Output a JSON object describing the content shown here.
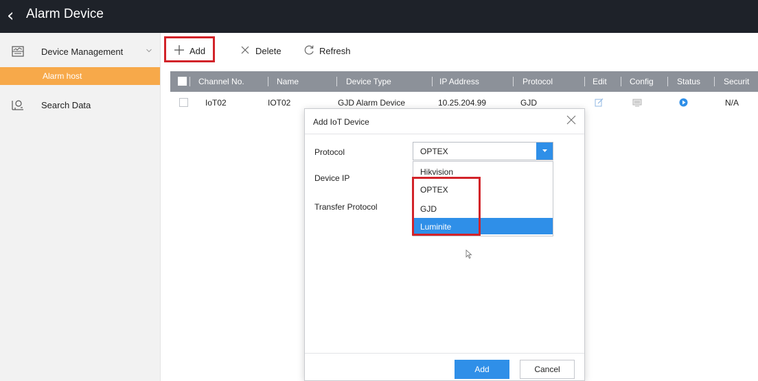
{
  "header": {
    "title": "Alarm Device"
  },
  "sidebar": {
    "items": [
      {
        "label": "Device Management",
        "icon": "device-management-icon"
      },
      {
        "label": "Alarm host"
      },
      {
        "label": "Search Data",
        "icon": "search-data-icon"
      }
    ]
  },
  "toolbar": {
    "add_label": "Add",
    "delete_label": "Delete",
    "refresh_label": "Refresh"
  },
  "table": {
    "columns": [
      "Channel No.",
      "Name",
      "Device Type",
      "IP Address",
      "Protocol",
      "Edit",
      "Config",
      "Status",
      "Securit"
    ],
    "rows": [
      {
        "channel_no": "IoT02",
        "name": "IOT02",
        "device_type": "GJD Alarm Device",
        "ip_address": "10.25.204.99",
        "protocol": "GJD",
        "security": "N/A"
      }
    ]
  },
  "dialog": {
    "title": "Add IoT Device",
    "protocol_label": "Protocol",
    "protocol_value": "OPTEX",
    "device_ip_label": "Device IP",
    "transfer_protocol_label": "Transfer Protocol",
    "protocol_options": [
      "Hikvision",
      "OPTEX",
      "GJD",
      "Luminite"
    ],
    "highlighted_option": "Luminite",
    "add_label": "Add",
    "cancel_label": "Cancel"
  },
  "colors": {
    "topbar": "#1e2229",
    "accent": "#2f8fe8",
    "sidebar_active": "#f7a94a",
    "table_header": "#8c9199",
    "highlight_box": "#d22329"
  }
}
